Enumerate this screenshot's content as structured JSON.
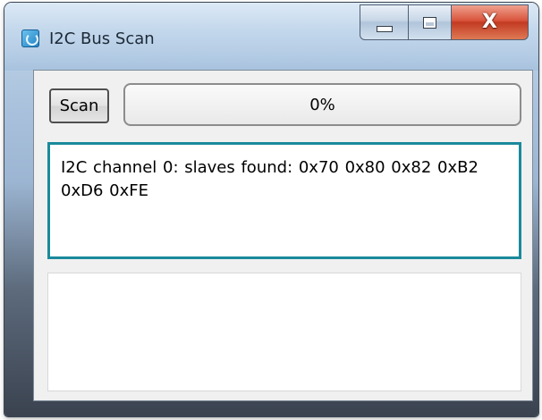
{
  "window": {
    "title": "I2C Bus Scan",
    "icon": "app-icon"
  },
  "controls": {
    "minimize_icon": "minimize-icon",
    "maximize_icon": "maximize-icon",
    "close_icon": "close-icon",
    "close_glyph": "X",
    "close_color": "#c23a22"
  },
  "toolbar": {
    "scan_label": "Scan"
  },
  "progress": {
    "value": 0,
    "text": "0%"
  },
  "output": {
    "text": "I2C channel 0: slaves found: 0x70 0x80 0x82 0xB2 0xD6 0xFE",
    "border_color": "#1a8a9c"
  },
  "log": {
    "text": ""
  }
}
